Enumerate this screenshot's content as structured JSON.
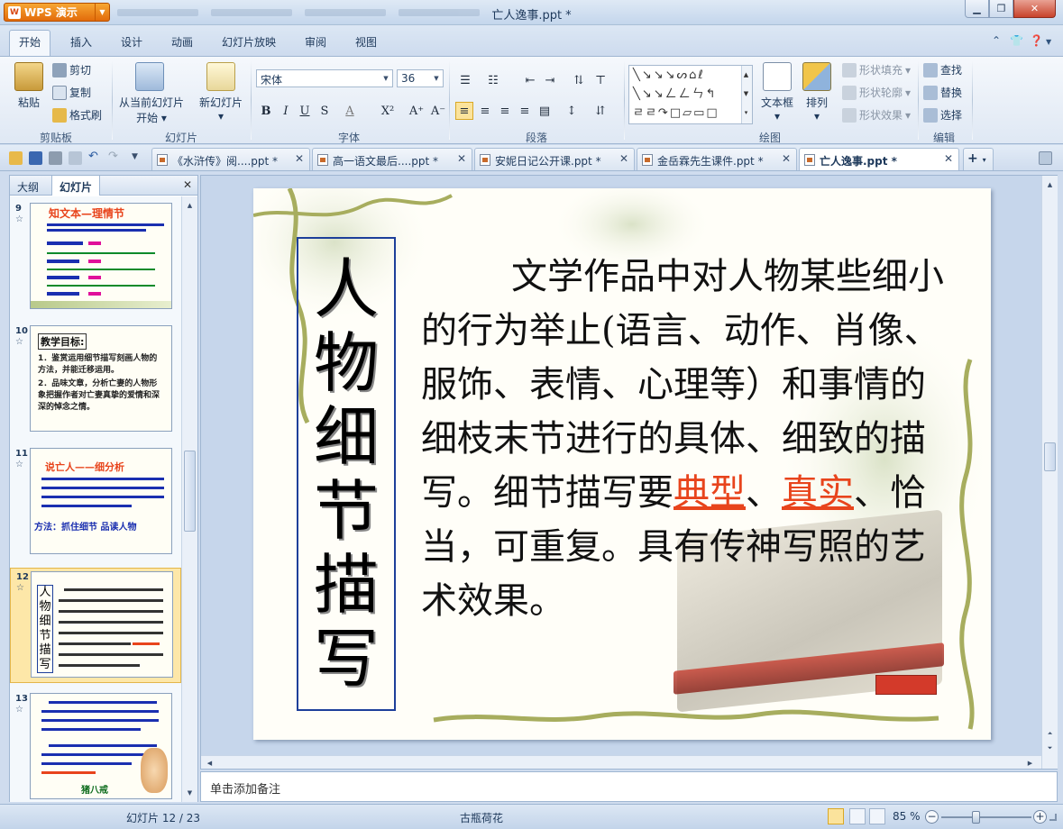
{
  "app": {
    "menu_label": "WPS 演示",
    "logo_text": "W",
    "title": "亡人逸事.ppt *"
  },
  "ribbon_tabs": [
    "开始",
    "插入",
    "设计",
    "动画",
    "幻灯片放映",
    "审阅",
    "视图"
  ],
  "groups": {
    "clipboard": {
      "label": "剪贴板",
      "paste": "粘贴",
      "cut": "剪切",
      "copy": "复制",
      "format_painter": "格式刷"
    },
    "slides": {
      "label": "幻灯片",
      "from_current_line1": "从当前幻灯片",
      "from_current_line2": "开始",
      "new_slide": "新幻灯片"
    },
    "font": {
      "label": "字体",
      "font_name": "宋体",
      "font_size": "36"
    },
    "paragraph": {
      "label": "段落"
    },
    "drawing": {
      "label": "绘图",
      "textbox": "文本框",
      "arrange": "排列",
      "shape_fill": "形状填充",
      "shape_outline": "形状轮廓",
      "shape_effect": "形状效果"
    },
    "editing": {
      "label": "编辑",
      "find": "查找",
      "replace": "替换",
      "select": "选择"
    }
  },
  "doc_tabs": [
    "《水浒传》阅....ppt *",
    "高一语文最后....ppt *",
    "安妮日记公开课.ppt *",
    "金岳霖先生课件.ppt *",
    "亡人逸事.ppt *"
  ],
  "left_panel": {
    "tabs": [
      "大纲",
      "幻灯片"
    ],
    "thumbnails": [
      {
        "num": "9",
        "title": "知文本—理情节"
      },
      {
        "num": "10",
        "title": "教学目标:",
        "lines": [
          "1．鉴赏运用细节描写刻画人物的方法，并能迁移运用。",
          "2．品味文章，分析亡妻的人物形象把握作者对亡妻真挚的爱情和深深的悼念之情。"
        ]
      },
      {
        "num": "11",
        "title": "说亡人——细分析",
        "footer": "方法：抓住细节   品读人物"
      },
      {
        "num": "12",
        "title": "人物细节描写"
      },
      {
        "num": "13",
        "footer": "猪八戒"
      }
    ]
  },
  "slide": {
    "vertical_title": [
      "人",
      "物",
      "细",
      "节",
      "描",
      "写"
    ],
    "text_before": "文学作品中对人物某些细小的行为举止(语言、动作、肖像、服饰、表情、心理等）和事情的细枝末节进行的具体、细致的描写。细节描写要",
    "highlight1": "典型",
    "text_mid": "、",
    "highlight2": "真实",
    "text_after": "、恰当，可重复。具有传神写照的艺术效果。"
  },
  "notes_placeholder": "单击添加备注",
  "status": {
    "slide_counter": "幻灯片 12 / 23",
    "theme": "古瓶荷花",
    "zoom": "85 %",
    "zoom_level_pct": 85
  },
  "colors": {
    "accent": "#e8441c",
    "title_border": "#1d3f9a",
    "selected_thumb": "#fde7a8"
  }
}
